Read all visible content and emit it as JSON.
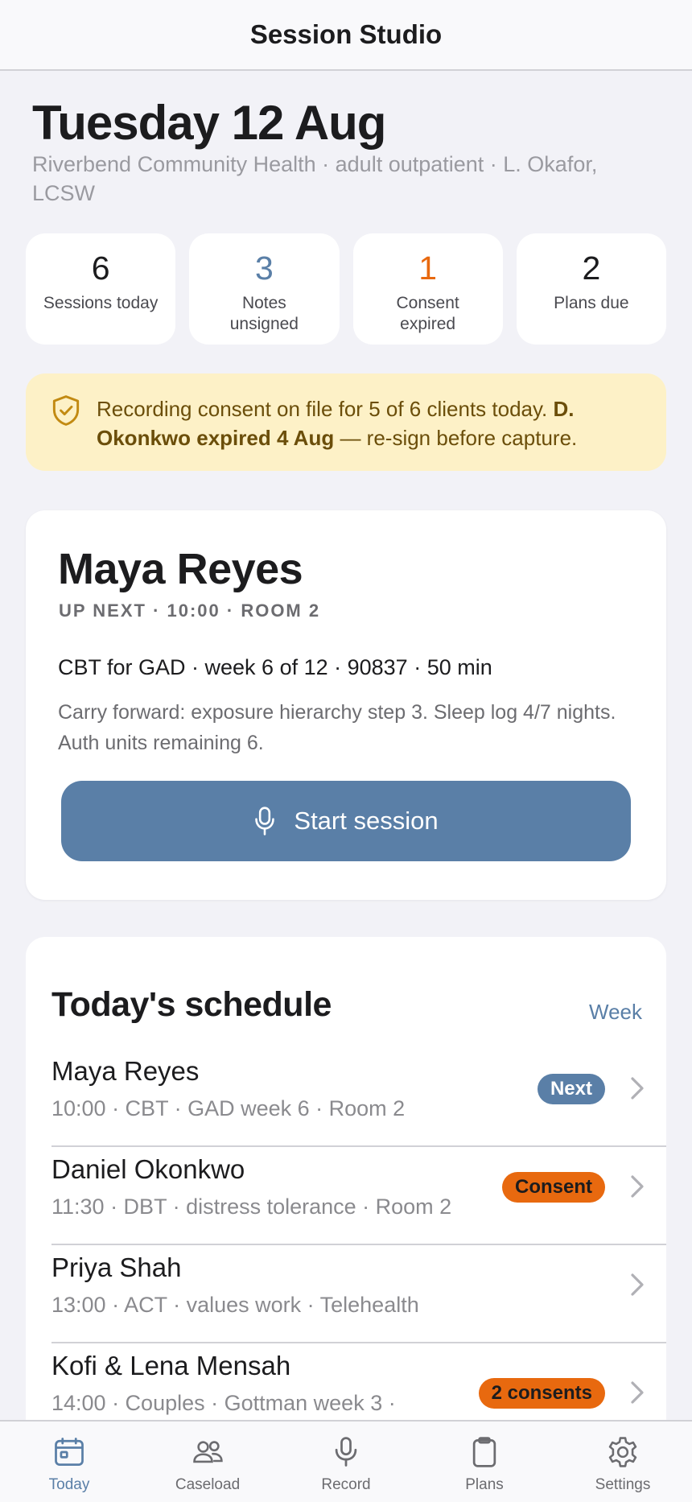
{
  "app": {
    "title": "Session Studio"
  },
  "header": {
    "date": "Tuesday 12 Aug",
    "subtitle": "Riverbend Community Health · adult outpatient · L. Okafor, LCSW"
  },
  "stats": [
    {
      "value": "6",
      "label": "Sessions today",
      "color": "#1c1c1e"
    },
    {
      "value": "3",
      "label": "Notes unsigned",
      "color": "#5a7fa7"
    },
    {
      "value": "1",
      "label": "Consent expired",
      "color": "#e8690f"
    },
    {
      "value": "2",
      "label": "Plans due",
      "color": "#1c1c1e"
    }
  ],
  "consent_banner": {
    "icon": "shield-check-icon",
    "text_lead": "Recording consent on file for 5 of 6 clients today. ",
    "text_bold": "D. Okonkwo expired 4 Aug",
    "text_tail": " — re-sign before capture."
  },
  "next_session": {
    "client": "Maya Reyes",
    "meta": "UP NEXT · 10:00 · ROOM 2",
    "plan": "CBT for GAD · week 6 of 12 · 90837 · 50 min",
    "notes": "Carry forward: exposure hierarchy step 3. Sleep log 4/7 nights. Auth units remaining 6.",
    "button_label": "Start session",
    "button_icon": "microphone-icon"
  },
  "schedule": {
    "title": "Today's schedule",
    "link_label": "Week",
    "rows": [
      {
        "name": "Maya Reyes",
        "detail": "10:00 · CBT · GAD week 6 · Room 2",
        "badge": "Next",
        "badge_type": "next"
      },
      {
        "name": "Daniel Okonkwo",
        "detail": "11:30 · DBT · distress tolerance · Room 2",
        "badge": "Consent",
        "badge_type": "warn"
      },
      {
        "name": "Priya Shah",
        "detail": "13:00 · ACT · values work · Telehealth",
        "badge": "",
        "badge_type": ""
      },
      {
        "name": "Kofi & Lena Mensah",
        "detail": "14:00 · Couples · Gottman week 3 ·",
        "badge": "2 consents",
        "badge_type": "warn"
      }
    ]
  },
  "tabbar": {
    "active": "Today",
    "tabs": [
      {
        "label": "Today",
        "icon": "calendar-icon"
      },
      {
        "label": "Caseload",
        "icon": "people-icon"
      },
      {
        "label": "Record",
        "icon": "microphone-icon"
      },
      {
        "label": "Plans",
        "icon": "clipboard-icon"
      },
      {
        "label": "Settings",
        "icon": "gear-icon"
      }
    ]
  },
  "colors": {
    "accent": "#5a7fa7",
    "warning": "#e8690f",
    "banner_bg": "#fdf1c7",
    "banner_text": "#6b4e0a"
  }
}
